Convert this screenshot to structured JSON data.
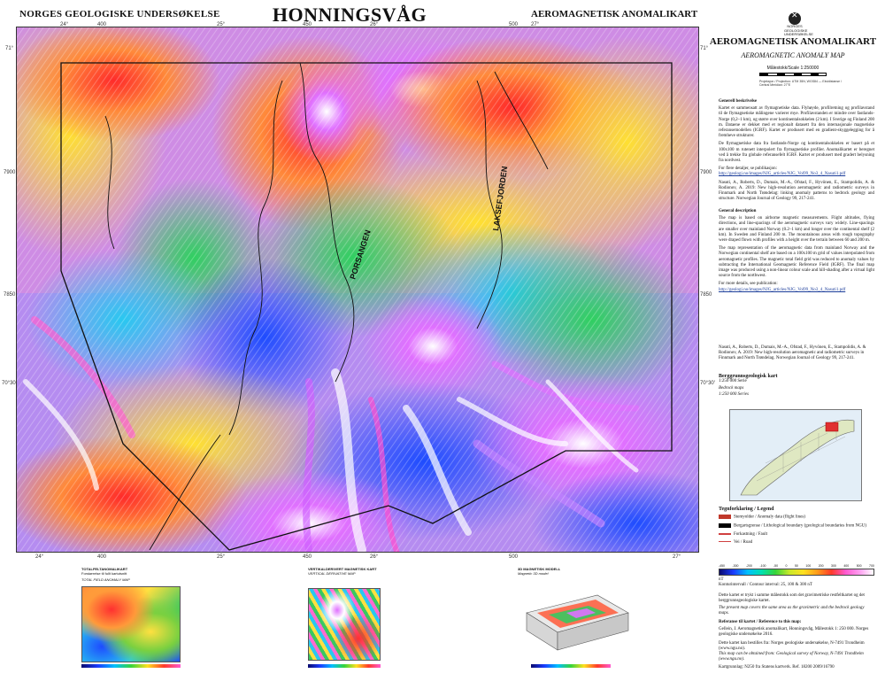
{
  "header": {
    "publisher": "NORGES GEOLOGISKE UNDERSØKELSE",
    "sheet_name": "HONNINGSVÅG",
    "map_type": "AEROMAGNETISK ANOMALIKART"
  },
  "map": {
    "place_labels": [
      "PORSANGEN",
      "LAKSEFJORDEN"
    ],
    "top_ticks": [
      "24°",
      "400",
      "25°",
      "450",
      "26°",
      "500",
      "27°"
    ],
    "bottom_ticks": [
      "24°",
      "400",
      "25°",
      "450",
      "26°",
      "500",
      "27°"
    ],
    "left_ticks": [
      "71°",
      "7900",
      "7850",
      "70°30'"
    ],
    "right_ticks": [
      "71°",
      "7900",
      "7850",
      "70°30'"
    ]
  },
  "sidebar": {
    "logo_label": "NORGES GEOLOGISKE UNDERSØKELSE",
    "title": "AEROMAGNETISK ANOMALIKART",
    "subtitle": "AEROMAGNETIC ANOMALY MAP",
    "scale": "Målestokk/Scale 1:250000",
    "projection": "Projeksjon / Projection: UTM 35N, WGS84 — Ekvidistanse / Central Meridian: 27°E",
    "generell_heading": "Generell beskrivelse",
    "generell_text": "Kartet er sammensatt av flymagnetiske data. Flyhøyde, profilretning og profilavstand til de flymagnetiske målingene varierer mye. Profilavstanden er mindre over fastlands-Norge (0,2–1 km), og større over kontinentalsokkelen (2 km). I Sverige og Finland 200 m. Dataene er dekket med et regionalt datasett fra den internasjonale magnetiske referansemodellen (IGRF). Kartet er produsert med en gradient-skyggelegging for å fremheve strukturer.",
    "generell_text2": "De flymagnetiske data fra fastlands-Norge og kontinentalsokkelen er basert på et 100x100 m rutenett interpolert fra flymagnetiske profiler. Anomalikartet er beregnet ved å trekke fra globale referansefelt IGRF. Kartet er produsert med gradert belysning fra nordvest.",
    "details_label": "For flere detaljer, se publikasjon:",
    "details_link": "http://geologi.no/images/NJG_articles/NJG_Vol99_No3_4_Nasuti1.pdf",
    "reference1": "Nasuti, A., Roberts, D., Dumais, M.-A., Ofstad, F., Hyvönen, E., Stampolidis, A. & Rodionov, A. 2019: New high-resolution aeromagnetic and radiometric surveys in Finnmark and North Trøndelag: linking anomaly patterns to bedrock geology and structure. Norwegian Journal of Geology 99, 217-241.",
    "general_heading": "General description",
    "general_text": "The map is based on airborne magnetic measurements. Flight altitudes, flying directions, and line-spacings of the aeromagnetic surveys vary widely. Line-spacings are smaller over mainland Norway (0.2–1 km) and longer over the continental shelf (2 km). In Sweden and Finland 200 m. The mountainous areas with rough topography were draped flown with profiles with a height over the terrain between 60 and 200 m.",
    "general_text2": "The map representation of the aeromagnetic data from mainland Norway and the Norwegian continental shelf are based on a 100x100 m grid of values interpolated from aeromagnetic profiles. The magnetic total field grid was reduced to anomaly values by subtracting the International Geomagnetic Reference Field (IGRF). The final map image was produced using a non-linear colour scale and hill-shading after a virtual light source from the northwest.",
    "more_details_label": "For more details, see publication:",
    "more_details_link": "http://geologi.no/images/NJG_articles/NJG_Vol99_No3_4_Nasuti1.pdf",
    "reference2": "Nasuti, A., Roberts, D., Dumais, M.-A., Ofstad, F., Hyvönen, E., Stampolidis, A. & Rodionov, A. 2019: New high-resolution aeromagnetic and radiometric surveys in Finnmark and North Trøndelag. Norwegian Journal of Geology 99, 217-241.",
    "bedrock_heading": "Berggrunnsgeologisk kart",
    "bedrock_scale": "1:250 000 Serie",
    "bedrock_en": "Bedrock maps",
    "bedrock_en_scale": "1:250 000 Series",
    "legend_heading": "Tegnforklaring / Legend",
    "legend": [
      {
        "label": "Stemyolder / Anomaly data (flight lines)",
        "color": "#c0392b"
      },
      {
        "label": "Bergartsgrense / Lithological boundary (geological boundaries from NGU)",
        "color": "#000000"
      },
      {
        "label": "Forkastning / Fault",
        "color": "#d04040"
      },
      {
        "label": "Vei / Road",
        "color": "#d04040"
      }
    ],
    "colorbar_unit": "nT",
    "colorbar_ticks": [
      "-450",
      "-300",
      "-200",
      "-100",
      "-50",
      "0",
      "50",
      "100",
      "200",
      "300",
      "400",
      "500",
      "700"
    ],
    "contour_note": "Konturintervall / Contour interval: 25, 100 & 300 nT",
    "note_no": "Dette kartet er trykt i samme målestokk som det gravimetriske restfeltkartet og det berggrunnsgeologiske kartet.",
    "note_en": "The present map covers the same area as the gravimetric and the bedrock geology maps.",
    "ref_heading": "Referanse til kartet / Reference to this map:",
    "ref_text": "Gellein, J. Aeromagnetisk anomalikart, Honningsvåg, Målestokk 1: 250 000. Norges geologiske undersøkelse 2016.",
    "contact_no": "Dette kartet kan bestilles fra: Norges geologiske undersøkelse, N-7491 Trondheim (www.ngu.no).",
    "contact_en": "This map can be obtained from: Geological survey of Norway, N-7491 Trondheim (www.ngu.no).",
    "print_note": "Kartgrunnlag: N250 fra Statens kartverk. Ref. 18200 2009/16790"
  },
  "bottom_panels": {
    "gradient_title": "TOTALFELTANOMALIKART",
    "gradient_sub": "Forstørrelse til fullt kartutsnitt",
    "gradient_en": "TOTAL FIELD ANOMALY MAP",
    "tilt_title": "VERTIKALDERIVERT MAGNETISK KART",
    "tilt_en": "VERTICAL DERIVATIVE MAP",
    "model_title": "3D MAGNETISK MODELL",
    "model_en": "Magnetic 3D model"
  }
}
